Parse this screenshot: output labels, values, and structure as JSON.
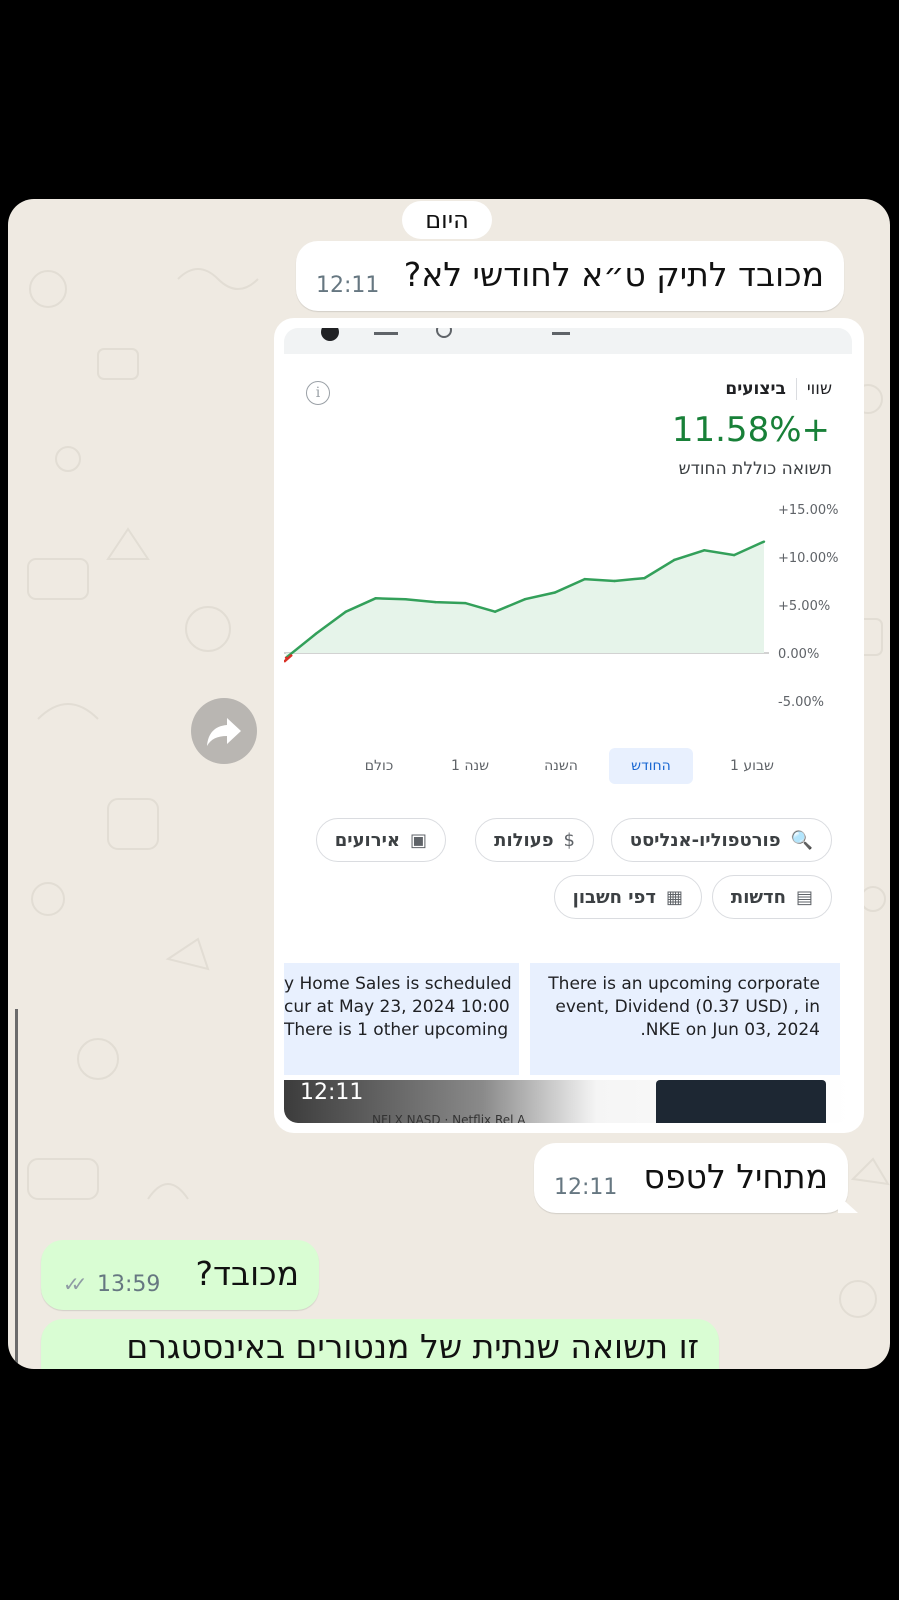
{
  "date_divider": "היום",
  "messages": {
    "m1": {
      "text": "מכובד לתיק ט״א לחודשי לא?",
      "time": "12:11"
    },
    "image": {
      "time": "12:11"
    },
    "m2": {
      "text": "מתחיל לטפס",
      "time": "12:11"
    },
    "m3": {
      "text": "מכובד?",
      "time": "13:59"
    },
    "m4": {
      "text": "זו תשואה שנתית של מנטורים באינסטגרם"
    }
  },
  "screenshot": {
    "tab_value": "שווי",
    "tab_performance": "ביצועים",
    "performance_value": "11.58%+",
    "performance_label": "תשואה כוללת החודש",
    "ranges": [
      "שבוע 1",
      "החודש",
      "השנה",
      "שנה 1",
      "כולם"
    ],
    "active_range": "החודש",
    "chips": {
      "analyst": "פורטפוליו-אנליסט",
      "actions": "פעולות",
      "events": "אירועים",
      "news": "חדשות",
      "statements": "דפי חשבון"
    },
    "news_left": [
      "y Home Sales is scheduled",
      "cur at May 23, 2024 10:00",
      "There is 1 other upcoming"
    ],
    "news_right": [
      "There is an upcoming corporate",
      "event, Dividend (0.37 USD) , in",
      ".NKE on Jun 03, 2024"
    ],
    "cut_text": "NFLX NASD · Netflix Rel A"
  },
  "chart_data": {
    "type": "area",
    "ylabel": "",
    "ytick_labels": [
      "+15.00%",
      "+10.00%",
      "+5.00%",
      "0.00%",
      "-5.00%"
    ],
    "ylim": [
      -5,
      15
    ],
    "x": [
      0,
      1,
      2,
      3,
      4,
      5,
      6,
      7,
      8,
      9,
      10,
      11,
      12,
      13,
      14,
      15,
      16
    ],
    "series": [
      {
        "values": [
          -0.5,
          2.0,
          4.3,
          5.7,
          5.6,
          5.3,
          5.2,
          4.3,
          5.6,
          6.3,
          7.7,
          7.5,
          7.8,
          9.7,
          10.7,
          10.2,
          11.6
        ]
      }
    ],
    "colors": {
      "line": "#33a05a",
      "fill": "#e6f4ea",
      "baseline": "#c4c4c4",
      "start": "#d93025"
    },
    "grid": false
  },
  "colors": {
    "incoming": "#ffffff",
    "outgoing": "#d9fdd3",
    "wallpaper": "#efeae2",
    "accent_green": "#188038"
  }
}
